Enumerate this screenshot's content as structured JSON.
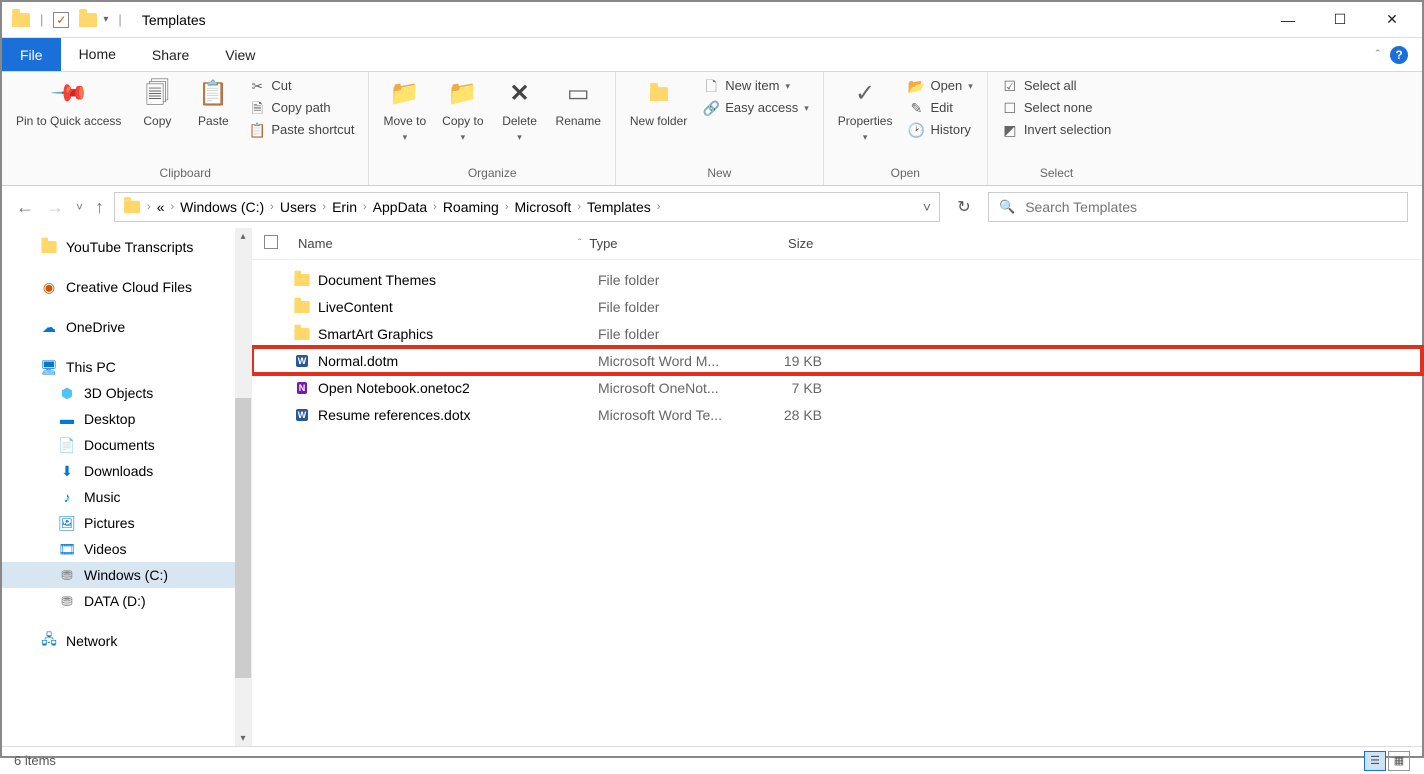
{
  "window": {
    "title": "Templates"
  },
  "tabs": {
    "file": "File",
    "home": "Home",
    "share": "Share",
    "view": "View"
  },
  "ribbon": {
    "clipboard": {
      "label": "Clipboard",
      "pin": "Pin to Quick access",
      "copy": "Copy",
      "paste": "Paste",
      "cut": "Cut",
      "copypath": "Copy path",
      "pasteshortcut": "Paste shortcut"
    },
    "organize": {
      "label": "Organize",
      "moveto": "Move to",
      "copyto": "Copy to",
      "delete": "Delete",
      "rename": "Rename"
    },
    "new": {
      "label": "New",
      "newfolder": "New folder",
      "newitem": "New item",
      "easyaccess": "Easy access"
    },
    "open": {
      "label": "Open",
      "properties": "Properties",
      "open": "Open",
      "edit": "Edit",
      "history": "History"
    },
    "select": {
      "label": "Select",
      "selectall": "Select all",
      "selectnone": "Select none",
      "invert": "Invert selection"
    }
  },
  "breadcrumbs": [
    "Windows (C:)",
    "Users",
    "Erin",
    "AppData",
    "Roaming",
    "Microsoft",
    "Templates"
  ],
  "search": {
    "placeholder": "Search Templates"
  },
  "tree": {
    "items": [
      {
        "label": "YouTube Transcripts",
        "level": 0,
        "icon": "folder"
      },
      {
        "label": "Creative Cloud Files",
        "level": 0,
        "icon": "cc"
      },
      {
        "label": "OneDrive",
        "level": 0,
        "icon": "cloud"
      },
      {
        "label": "This PC",
        "level": 0,
        "icon": "pc"
      },
      {
        "label": "3D Objects",
        "level": 1,
        "icon": "3d"
      },
      {
        "label": "Desktop",
        "level": 1,
        "icon": "desktop"
      },
      {
        "label": "Documents",
        "level": 1,
        "icon": "doc"
      },
      {
        "label": "Downloads",
        "level": 1,
        "icon": "down"
      },
      {
        "label": "Music",
        "level": 1,
        "icon": "music"
      },
      {
        "label": "Pictures",
        "level": 1,
        "icon": "pic"
      },
      {
        "label": "Videos",
        "level": 1,
        "icon": "vid"
      },
      {
        "label": "Windows (C:)",
        "level": 1,
        "icon": "drive",
        "selected": true
      },
      {
        "label": "DATA (D:)",
        "level": 1,
        "icon": "drive"
      },
      {
        "label": "Network",
        "level": 0,
        "icon": "net"
      }
    ]
  },
  "columns": {
    "name": "Name",
    "type": "Type",
    "size": "Size"
  },
  "files": [
    {
      "name": "Document Themes",
      "type": "File folder",
      "size": "",
      "icon": "folder"
    },
    {
      "name": "LiveContent",
      "type": "File folder",
      "size": "",
      "icon": "folder"
    },
    {
      "name": "SmartArt Graphics",
      "type": "File folder",
      "size": "",
      "icon": "folder"
    },
    {
      "name": "Normal.dotm",
      "type": "Microsoft Word M...",
      "size": "19 KB",
      "icon": "word",
      "highlight": true
    },
    {
      "name": "Open Notebook.onetoc2",
      "type": "Microsoft OneNot...",
      "size": "7 KB",
      "icon": "onenote"
    },
    {
      "name": "Resume references.dotx",
      "type": "Microsoft Word Te...",
      "size": "28 KB",
      "icon": "word"
    }
  ],
  "status": {
    "count": "6 items"
  }
}
